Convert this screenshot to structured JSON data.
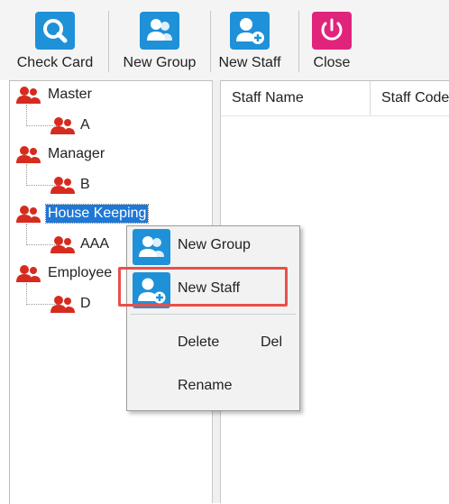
{
  "toolbar": {
    "check_card": "Check Card",
    "new_group": "New Group",
    "new_staff": "New Staff",
    "close": "Close",
    "colors": {
      "blue_button": "#1e91d9",
      "close_button": "#e0247b"
    }
  },
  "tree": {
    "groups": [
      {
        "label": "Master",
        "children": [
          "A"
        ]
      },
      {
        "label": "Manager",
        "children": [
          "B"
        ]
      },
      {
        "label": "House Keeping",
        "children": [
          "AAA"
        ],
        "selected": true
      },
      {
        "label": "Employee",
        "children": [
          "D"
        ]
      }
    ],
    "icon_color": "#d62b1f"
  },
  "list": {
    "columns": [
      "Staff Name",
      "Staff Code"
    ],
    "rows": []
  },
  "context_menu": {
    "items": [
      {
        "label": "New Group",
        "icon": "group-icon"
      },
      {
        "label": "New Staff",
        "icon": "add-staff-icon",
        "highlighted": true
      },
      {
        "label": "Delete",
        "shortcut": "Del"
      },
      {
        "label": "Rename"
      }
    ],
    "highlight_color": "#e8504a"
  }
}
